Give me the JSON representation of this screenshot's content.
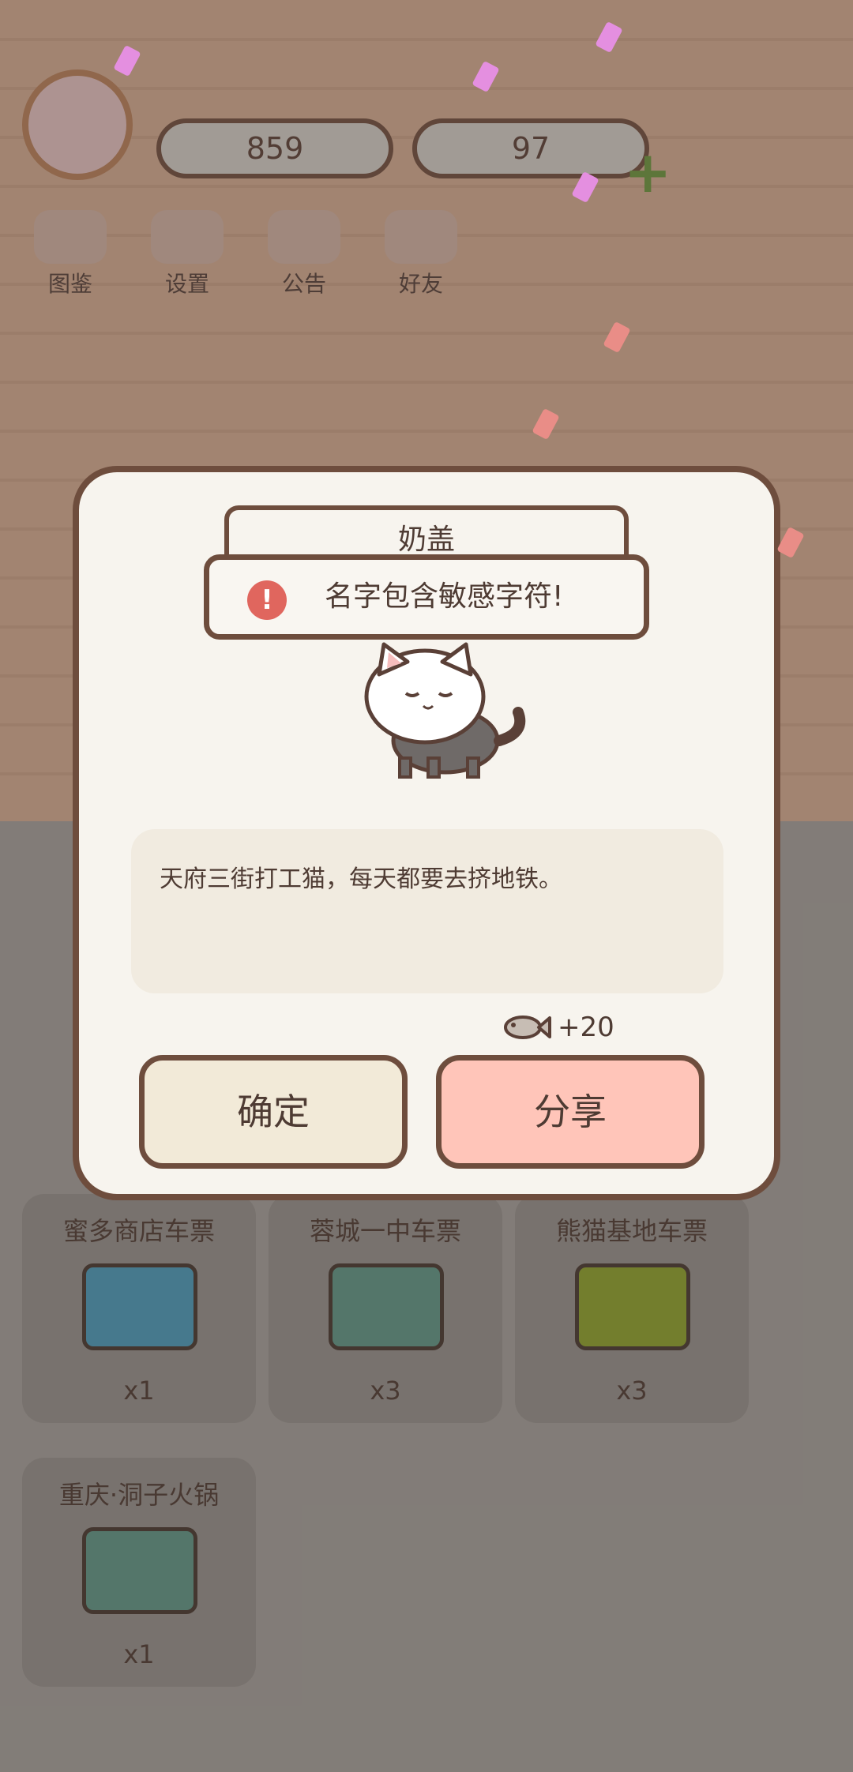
{
  "hud": {
    "fish_count": "859",
    "heart_count": "97",
    "buttons": [
      {
        "label": "图鉴"
      },
      {
        "label": "设置"
      },
      {
        "label": "公告"
      },
      {
        "label": "好友"
      }
    ]
  },
  "tickets": [
    {
      "title": "蜜多商店车票",
      "count": "x1",
      "color": "#4a94b0"
    },
    {
      "title": "蓉城一中车票",
      "count": "x3",
      "color": "#5d8f80"
    },
    {
      "title": "熊猫基地车票",
      "count": "x3",
      "color": "#889a2c"
    },
    {
      "title": "重庆·洞子火锅",
      "count": "x1",
      "color": "#5d8f80"
    }
  ],
  "modal": {
    "name_value": "奶盖",
    "toast_message": "名字包含敏感字符!",
    "alert_glyph": "!",
    "description": "天府三街打工猫，每天都要去挤地铁。",
    "reward": "+20",
    "confirm_label": "确定",
    "share_label": "分享"
  },
  "colors": {
    "border": "#6e4d3d",
    "share_button": "#ffc5b9",
    "confirm_button": "#f2ead8",
    "alert": "#e0665e"
  }
}
